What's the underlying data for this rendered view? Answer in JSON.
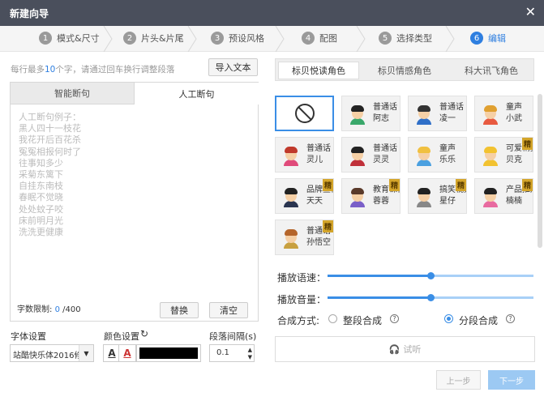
{
  "window": {
    "title": "新建向导",
    "close_glyph": "✕"
  },
  "steps": [
    {
      "num": "1",
      "label": "模式&尺寸"
    },
    {
      "num": "2",
      "label": "片头&片尾"
    },
    {
      "num": "3",
      "label": "预设风格"
    },
    {
      "num": "4",
      "label": "配图"
    },
    {
      "num": "5",
      "label": "选择类型"
    },
    {
      "num": "6",
      "label": "编辑"
    }
  ],
  "left": {
    "hint_prefix": "每行最多",
    "hint_num": "10",
    "hint_suffix": "个字，请通过回车换行调整段落",
    "import_button": "导入文本",
    "tabs": {
      "smart": "智能断句",
      "manual": "人工断句"
    },
    "text_lines": [
      "人工断句例子：",
      "黑人四十一枝花",
      "我花开后百花杀",
      "冤冤相报何时了",
      "往事知多少",
      "采菊东篱下",
      "自挂东南枝",
      "春眠不觉晓",
      "处处蚊子咬",
      "床前明月光",
      "洗洗更健康"
    ],
    "word_limit_label": "字数限制:",
    "word_limit_count": "0",
    "word_limit_max": "/400",
    "replace_button": "替换",
    "clear_button": "清空",
    "font_label": "字体设置",
    "font_value": "站酷快乐体2016修订版",
    "color_label": "颜色设置",
    "refresh_glyph": "↻",
    "bold_glyph": "A",
    "italic_glyph": "A",
    "spacing_label": "段落间隔(s)",
    "spacing_value": "0.1"
  },
  "right": {
    "tabs": [
      "标贝悦读角色",
      "标贝情感角色",
      "科大讯飞角色"
    ],
    "voices": [
      {
        "name": "",
        "line2": "",
        "type": "none"
      },
      {
        "name": "普通话",
        "line2": "阿志",
        "type": "boy"
      },
      {
        "name": "普通话",
        "line2": "凌一",
        "type": "boy2"
      },
      {
        "name": "童声",
        "line2": "小武",
        "type": "kid"
      },
      {
        "name": "普通话",
        "line2": "灵儿",
        "type": "girl"
      },
      {
        "name": "普通话",
        "line2": "灵灵",
        "type": "girl2"
      },
      {
        "name": "童声",
        "line2": "乐乐",
        "type": "kidgirl"
      },
      {
        "name": "可爱精灵",
        "line2": "贝克",
        "type": "pet",
        "badge": "精"
      },
      {
        "name": "品牌宣传",
        "line2": "天天",
        "type": "man",
        "badge": "精"
      },
      {
        "name": "教育课件",
        "line2": "蓉蓉",
        "type": "woman",
        "badge": "精"
      },
      {
        "name": "搞笑视频",
        "line2": "星仔",
        "type": "funny",
        "badge": "精"
      },
      {
        "name": "产品推广",
        "line2": "楠楠",
        "type": "girl3",
        "badge": "精"
      },
      {
        "name": "普通话",
        "line2": "孙悟空",
        "type": "monkey",
        "badge": "精"
      }
    ],
    "speed_label": "播放语速：",
    "volume_label": "播放音量：",
    "speed_level": 0.5,
    "volume_level": 0.5,
    "synth_label": "合成方式:",
    "synth_whole": "整段合成",
    "synth_segment": "分段合成",
    "preview_button": "试听",
    "prev_button": "上一步",
    "next_button": "下一步"
  }
}
